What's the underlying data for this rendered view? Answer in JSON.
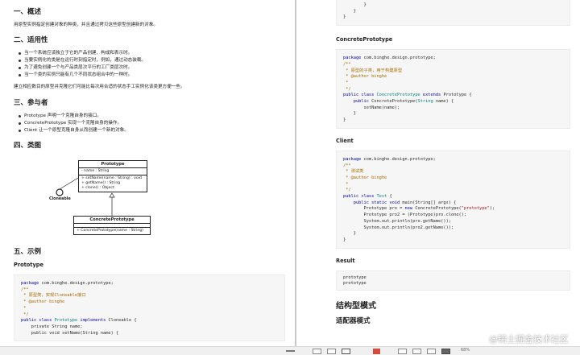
{
  "left": {
    "s1": {
      "heading": "一、概述",
      "text": "用原型实例指定创建对象的种类，并且通过拷贝这些原型创建新的对象。"
    },
    "s2": {
      "heading": "二、适用性",
      "items": [
        "当一个系统应该独立于它的产品创建、构成和表示时。",
        "当要实例化的类是在运行时刻指定时，例如，通过动态装载。",
        "为了避免创建一个与产品类层次平行的工厂类层次时。",
        "当一个类的实例只能有几个不同状态组合中的一种时。"
      ],
      "note": "建立相应数目的原型并克隆它们可能比每次用合适的状态手工实例化该类更方便一些。"
    },
    "s3": {
      "heading": "三、参与者",
      "items": [
        "Prototype 声明一个克隆自身的接口。",
        "ConcretePrototype 实现一个克隆自身的操作。",
        "Client 让一个原型克隆自身从而创建一个新的对象。"
      ]
    },
    "s4": {
      "heading": "四、类图",
      "uml": {
        "prototype_title": "Prototype",
        "prototype_field": "- name : String",
        "prototype_methods": [
          "+ setName(name : String) : void",
          "+ getName() : String",
          "+ clone() : Object"
        ],
        "cloneable": "Cloneable",
        "concrete_title": "ConcretePrototype",
        "concrete_method": "+ ConcretePrototype(name : String)"
      }
    },
    "s5": {
      "heading": "五、示例",
      "sub": "Prototype",
      "code": {
        "l1": "com.binghe.design.prototype",
        "c1": "/**",
        "c2": " * 原型类，实现Cloneable接口",
        "c3": " * @author binghe",
        "c4": " *",
        "c5": " */",
        "decl_name": "Prototype",
        "decl_iface": "Cloneable",
        "field": "private String name;",
        "method": "public void setName(String name) {"
      }
    }
  },
  "right": {
    "top_code": {
      "b1": "        }",
      "b2": "    }",
      "b3": "}"
    },
    "concrete": {
      "heading": "ConcretePrototype",
      "pkg": "com.binghe.design.prototype",
      "c1": "/**",
      "c2": " * 原型的子类，用于构建原型",
      "c3": " * @author binghe",
      "c4": " *",
      "c5": " */",
      "cls": "ConcretePrototype",
      "base": "Prototype",
      "ctor": "ConcretePrototype",
      "ctor_arg": "String",
      "body": "setName(name);",
      "close1": "    }",
      "close2": "}"
    },
    "client": {
      "heading": "Client",
      "pkg": "com.binghe.design.prototype",
      "c1": "/**",
      "c2": " * 测试类",
      "c3": " * @author binghe",
      "c4": " *",
      "c5": " */",
      "cls": "Test",
      "main_sig": "main(String[] args) {",
      "l1a": "Prototype pro = ",
      "l1b": "ConcretePrototype(",
      "l1c": "\"prototype\"",
      "l1d": ");",
      "l2": "Prototype pro2 = (Prototype)pro.clone();",
      "l3": "System.out.println(pro.getName());",
      "l4": "System.out.println(pro2.getName());",
      "close1": "    }",
      "close2": "}"
    },
    "result": {
      "heading": "Result",
      "out1": "prototype",
      "out2": "prototype"
    },
    "section_title": "结构型模式",
    "sub_title": "适配器模式"
  },
  "statusbar": {
    "zoom": "68%"
  },
  "watermark": "@稀土掘金技术社区"
}
